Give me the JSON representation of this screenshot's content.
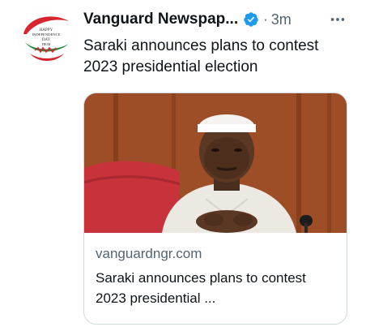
{
  "tweet": {
    "author_name": "Vanguard Newspap...",
    "dot_separator": "·",
    "time": "3m",
    "text": "Saraki announces plans to contest 2023 presidential election",
    "avatar": {
      "line1": "HAPPY",
      "line2": "INDEPENDENCE",
      "line3": "DAY",
      "line4": "FROM"
    },
    "icons": {
      "verified": "verified-badge-icon",
      "more": "more-options-icon"
    },
    "colors": {
      "text_primary": "#0f1419",
      "text_secondary": "#536471",
      "verified_blue": "#1d9bf0",
      "card_border": "#cfd9de"
    }
  },
  "card": {
    "domain": "vanguardngr.com",
    "title": "Saraki announces plans to contest 2023 presidential ..."
  }
}
